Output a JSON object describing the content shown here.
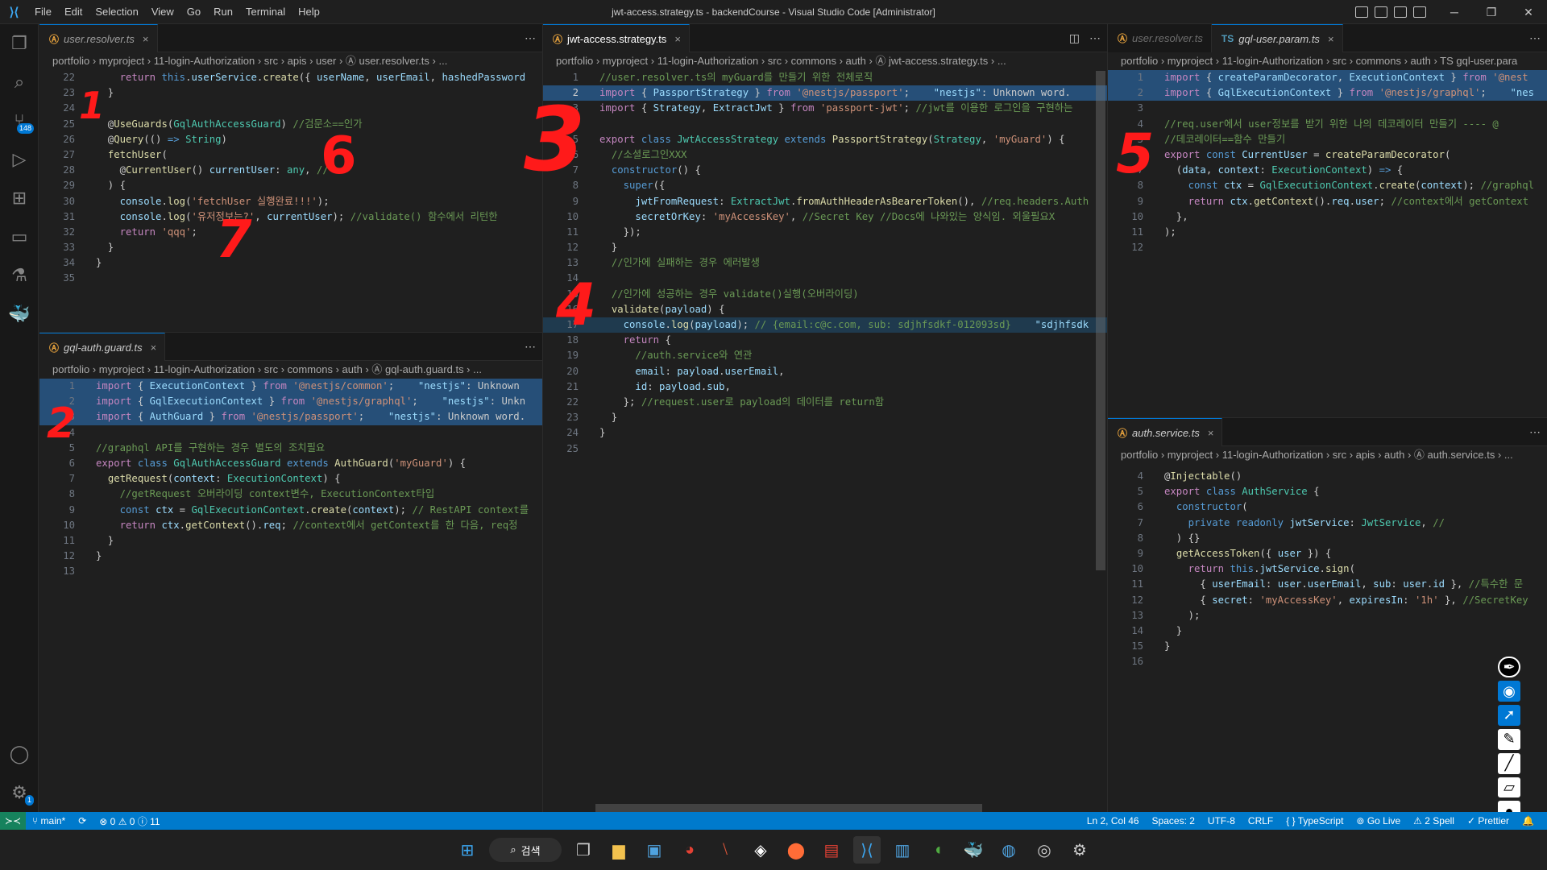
{
  "window": {
    "title": "jwt-access.strategy.ts - backendCourse - Visual Studio Code [Administrator]",
    "menu": [
      "File",
      "Edit",
      "Selection",
      "View",
      "Go",
      "Run",
      "Terminal",
      "Help"
    ]
  },
  "activity": {
    "scm_badge": "148",
    "settings_badge": "1"
  },
  "groups": {
    "top_left": {
      "tabs": [
        {
          "label": "user.resolver.ts",
          "icon": "Ⓐ",
          "close": "×"
        }
      ],
      "crumbs": "portfolio › myproject › 11-login-Authorization › src › apis › user › Ⓐ user.resolver.ts › ...",
      "lines": [
        {
          "n": "22",
          "html": "    <span class='k2'>return</span> <span class='k'>this</span>.<span class='v'>userService</span>.<span class='f'>create</span>({ <span class='v'>userName</span>, <span class='v'>userEmail</span>, <span class='v'>hashedPassword</span>"
        },
        {
          "n": "23",
          "html": "  }"
        },
        {
          "n": "24",
          "html": ""
        },
        {
          "n": "25",
          "html": "  @<span class='f'>UseGuards</span>(<span class='t'>GqlAuthAccessGuard</span>) <span class='c'>//검문소==인가</span>"
        },
        {
          "n": "26",
          "html": "  @<span class='f'>Query</span>(() <span class='k'>=&gt;</span> <span class='t'>String</span>)"
        },
        {
          "n": "27",
          "html": "  <span class='f'>fetchUser</span>("
        },
        {
          "n": "28",
          "html": "    @<span class='f'>CurrentUser</span>() <span class='v'>currentUser</span>: <span class='t'>any</span>, <span class='c'>//</span>"
        },
        {
          "n": "29",
          "html": "  ) {"
        },
        {
          "n": "30",
          "html": "    <span class='v'>console</span>.<span class='f'>log</span>(<span class='s'>'fetchUser 실행완료!!!'</span>);"
        },
        {
          "n": "31",
          "html": "    <span class='v'>console</span>.<span class='f'>log</span>(<span class='s'>'유저정보는?'</span>, <span class='v'>currentUser</span>); <span class='c'>//validate() 함수에서 리턴한</span>"
        },
        {
          "n": "32",
          "html": "    <span class='k2'>return</span> <span class='s'>'qqq'</span>;"
        },
        {
          "n": "33",
          "html": "  }"
        },
        {
          "n": "34",
          "html": "}"
        },
        {
          "n": "35",
          "html": ""
        }
      ]
    },
    "bottom_left": {
      "tabs": [
        {
          "label": "gql-auth.guard.ts",
          "icon": "Ⓐ",
          "close": "×"
        }
      ],
      "crumbs": "portfolio › myproject › 11-login-Authorization › src › commons › auth › Ⓐ gql-auth.guard.ts › ...",
      "lines": [
        {
          "n": "1",
          "sel": true,
          "html": "<span class='k2'>import</span> { <span class='v'>ExecutionContext</span> } <span class='k2'>from</span> <span class='s'>'@nestjs/common'</span>;    <span class='v'>\"nestjs\"</span>: Unknown"
        },
        {
          "n": "2",
          "sel": true,
          "html": "<span class='k2'>import</span> { <span class='v'>GqlExecutionContext</span> } <span class='k2'>from</span> <span class='s'>'@nestjs/graphql'</span>;    <span class='v'>\"nestjs\"</span>: Unkn"
        },
        {
          "n": "3",
          "sel": true,
          "html": "<span class='k2'>import</span> { <span class='v'>AuthGuard</span> } <span class='k2'>from</span> <span class='s'>'@nestjs/passport'</span>;    <span class='v'>\"nestjs\"</span>: Unknown word."
        },
        {
          "n": "4",
          "html": ""
        },
        {
          "n": "5",
          "html": "<span class='c'>//graphql API를 구현하는 경우 별도의 조치필요</span>"
        },
        {
          "n": "6",
          "html": "<span class='k2'>export</span> <span class='k'>class</span> <span class='t'>GqlAuthAccessGuard</span> <span class='k'>extends</span> <span class='f'>AuthGuard</span>(<span class='s'>'myGuard'</span>) {"
        },
        {
          "n": "7",
          "html": "  <span class='f'>getRequest</span>(<span class='v'>context</span>: <span class='t'>ExecutionContext</span>) {"
        },
        {
          "n": "8",
          "html": "    <span class='c'>//getRequest 오버라이딩 context변수, ExecutionContext타입</span>"
        },
        {
          "n": "9",
          "html": "    <span class='k'>const</span> <span class='v'>ctx</span> = <span class='t'>GqlExecutionContext</span>.<span class='f'>create</span>(<span class='v'>context</span>); <span class='c'>// RestAPI context를</span>"
        },
        {
          "n": "10",
          "html": "    <span class='k2'>return</span> <span class='v'>ctx</span>.<span class='f'>getContext</span>().<span class='v'>req</span>; <span class='c'>//context에서 getContext를 한 다음, req정</span>"
        },
        {
          "n": "11",
          "html": "  }"
        },
        {
          "n": "12",
          "html": "}"
        },
        {
          "n": "13",
          "html": ""
        }
      ]
    },
    "middle": {
      "tabs": [
        {
          "label": "jwt-access.strategy.ts",
          "icon": "Ⓐ",
          "close": "×"
        }
      ],
      "crumbs": "portfolio › myproject › 11-login-Authorization › src › commons › auth › Ⓐ jwt-access.strategy.ts › ...",
      "lines": [
        {
          "n": "1",
          "html": "<span class='c'>//user.resolver.ts의 myGuard를 만들기 위한 전체로직</span>"
        },
        {
          "n": "2",
          "sel": true,
          "cur": true,
          "html": "<span class='k2'>import</span> { <span class='v'>PassportStrategy</span> } <span class='k2'>from</span> <span class='s'>'@nestjs/passport'</span>;    <span class='v'>\"nestjs\"</span>: Unknown word."
        },
        {
          "n": "3",
          "html": "<span class='k2'>import</span> { <span class='v'>Strategy</span>, <span class='v'>ExtractJwt</span> } <span class='k2'>from</span> <span class='s'>'passport-jwt'</span>; <span class='c'>//jwt를 이용한 로그인을 구현하는</span>"
        },
        {
          "n": "4",
          "html": ""
        },
        {
          "n": "5",
          "html": "<span class='k2'>export</span> <span class='k'>class</span> <span class='t'>JwtAccessStrategy</span> <span class='k'>extends</span> <span class='f'>PassportStrategy</span>(<span class='t'>Strategy</span>, <span class='s'>'myGuard'</span>) {"
        },
        {
          "n": "6",
          "html": "  <span class='c'>//소셜로그인XXX</span>"
        },
        {
          "n": "7",
          "html": "  <span class='k'>constructor</span>() {"
        },
        {
          "n": "8",
          "html": "    <span class='k'>super</span>({"
        },
        {
          "n": "9",
          "html": "      <span class='v'>jwtFromRequest</span>: <span class='t'>ExtractJwt</span>.<span class='f'>fromAuthHeaderAsBearerToken</span>(), <span class='c'>//req.headers.Auth</span>"
        },
        {
          "n": "10",
          "html": "      <span class='v'>secretOrKey</span>: <span class='s'>'myAccessKey'</span>, <span class='c'>//Secret Key //Docs에 나와있는 양식임. 외울필요X</span>"
        },
        {
          "n": "11",
          "html": "    });"
        },
        {
          "n": "12",
          "html": "  }"
        },
        {
          "n": "13",
          "html": "  <span class='c'>//인가에 실패하는 경우 에러발생</span>"
        },
        {
          "n": "14",
          "html": ""
        },
        {
          "n": "15",
          "html": "  <span class='c'>//인가에 성공하는 경우 validate()실행(오버라이딩)</span>"
        },
        {
          "n": "16",
          "html": "  <span class='f'>validate</span>(<span class='v'>payload</span>) {"
        },
        {
          "n": "17",
          "hl": true,
          "html": "    <span class='v'>console</span>.<span class='f'>log</span>(<span class='v'>payload</span>); <span class='c'>// {email:c@c.com, sub: sdjhfsdkf-012093sd}</span>    <span class='v'>\"sdjhfsdk</span>"
        },
        {
          "n": "18",
          "html": "    <span class='k2'>return</span> {"
        },
        {
          "n": "19",
          "html": "      <span class='c'>//auth.service와 연관</span>"
        },
        {
          "n": "20",
          "html": "      <span class='v'>email</span>: <span class='v'>payload</span>.<span class='v'>userEmail</span>,"
        },
        {
          "n": "21",
          "html": "      <span class='v'>id</span>: <span class='v'>payload</span>.<span class='v'>sub</span>,"
        },
        {
          "n": "22",
          "html": "    }; <span class='c'>//request.user로 payload의 데이터를 return함</span>"
        },
        {
          "n": "23",
          "html": "  }"
        },
        {
          "n": "24",
          "html": "}"
        },
        {
          "n": "25",
          "html": ""
        }
      ]
    },
    "top_right": {
      "tabs": [
        {
          "label": "user.resolver.ts",
          "icon": "Ⓐ",
          "close": ""
        },
        {
          "label": "gql-user.param.ts",
          "icon": "TS",
          "close": "×"
        }
      ],
      "crumbs": "portfolio › myproject › 11-login-Authorization › src › commons › auth › TS gql-user.para",
      "lines": [
        {
          "n": "1",
          "sel": true,
          "html": "<span class='k2'>import</span> { <span class='v'>createParamDecorator</span>, <span class='v'>ExecutionContext</span> } <span class='k2'>from</span> <span class='s'>'@nest</span>"
        },
        {
          "n": "2",
          "sel": true,
          "html": "<span class='k2'>import</span> { <span class='v'>GqlExecutionContext</span> } <span class='k2'>from</span> <span class='s'>'@nestjs/graphql'</span>;    <span class='v'>\"nes</span>"
        },
        {
          "n": "3",
          "html": ""
        },
        {
          "n": "4",
          "html": "<span class='c'>//req.user에서 user정보를 받기 위한 나의 데코레이터 만들기 ---- @</span>"
        },
        {
          "n": "5",
          "html": "<span class='c'>//데코레이터==함수 만들기</span>"
        },
        {
          "n": "6",
          "html": "<span class='k2'>export</span> <span class='k'>const</span> <span class='v'>CurrentUser</span> = <span class='f'>createParamDecorator</span>("
        },
        {
          "n": "7",
          "html": "  (<span class='v'>data</span>, <span class='v'>context</span>: <span class='t'>ExecutionContext</span>) <span class='k'>=&gt;</span> {"
        },
        {
          "n": "8",
          "html": "    <span class='k'>const</span> <span class='v'>ctx</span> = <span class='t'>GqlExecutionContext</span>.<span class='f'>create</span>(<span class='v'>context</span>); <span class='c'>//graphql</span>"
        },
        {
          "n": "9",
          "html": "    <span class='k2'>return</span> <span class='v'>ctx</span>.<span class='f'>getContext</span>().<span class='v'>req</span>.<span class='v'>user</span>; <span class='c'>//context에서 getContext</span>"
        },
        {
          "n": "10",
          "html": "  },"
        },
        {
          "n": "11",
          "html": ");"
        },
        {
          "n": "12",
          "html": ""
        }
      ]
    },
    "bottom_right": {
      "tabs": [
        {
          "label": "auth.service.ts",
          "icon": "Ⓐ",
          "close": "×"
        }
      ],
      "crumbs": "portfolio › myproject › 11-login-Authorization › src › apis › auth › Ⓐ auth.service.ts › ...",
      "lines": [
        {
          "n": "4",
          "html": "@<span class='f'>Injectable</span>()"
        },
        {
          "n": "5",
          "html": "<span class='k2'>export</span> <span class='k'>class</span> <span class='t'>AuthService</span> {"
        },
        {
          "n": "6",
          "html": "  <span class='k'>constructor</span>("
        },
        {
          "n": "7",
          "html": "    <span class='k'>private</span> <span class='k'>readonly</span> <span class='v'>jwtService</span>: <span class='t'>JwtService</span>, <span class='c'>//</span>"
        },
        {
          "n": "8",
          "html": "  ) {}"
        },
        {
          "n": "9",
          "html": "  <span class='f'>getAccessToken</span>({ <span class='v'>user</span> }) {"
        },
        {
          "n": "10",
          "html": "    <span class='k2'>return</span> <span class='k'>this</span>.<span class='v'>jwtService</span>.<span class='f'>sign</span>("
        },
        {
          "n": "11",
          "html": "      { <span class='v'>userEmail</span>: <span class='v'>user</span>.<span class='v'>userEmail</span>, <span class='v'>sub</span>: <span class='v'>user</span>.<span class='v'>id</span> }, <span class='c'>//특수한 문</span>"
        },
        {
          "n": "12",
          "html": "      { <span class='v'>secret</span>: <span class='s'>'myAccessKey'</span>, <span class='v'>expiresIn</span>: <span class='s'>'1h'</span> }, <span class='c'>//SecretKey</span>"
        },
        {
          "n": "13",
          "html": "    );"
        },
        {
          "n": "14",
          "html": "  }"
        },
        {
          "n": "15",
          "html": "}"
        },
        {
          "n": "16",
          "html": ""
        }
      ]
    }
  },
  "annotations": [
    "1",
    "2",
    "3",
    "4",
    "5",
    "6",
    "7"
  ],
  "statusbar": {
    "branch": "main*",
    "problems": "⊗ 0 ⚠ 0 ⓘ 11",
    "position": "Ln 2, Col 46",
    "spaces": "Spaces: 2",
    "encoding": "UTF-8",
    "eol": "CRLF",
    "language": "{ } TypeScript",
    "golive": "Go Live",
    "spell": "⚠ 2 Spell",
    "prettier": "✓ Prettier"
  },
  "taskbar": {
    "search": "검색"
  }
}
